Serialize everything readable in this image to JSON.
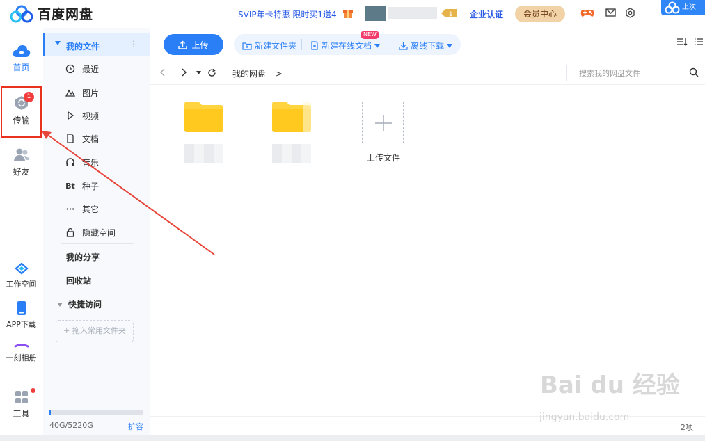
{
  "app": {
    "name": "百度网盘"
  },
  "header": {
    "promo": "SVIP年卡特惠 限时买1送4",
    "svip_badge": "$",
    "enterprise": "企业认证",
    "vip_center": "会员中心",
    "widget_label": "上次"
  },
  "leftnav": {
    "home": "首页",
    "transfer": "传输",
    "transfer_badge": "1",
    "friends": "好友",
    "workspace": "工作空间",
    "app_download": "APP下载",
    "album": "一刻相册",
    "tools": "工具"
  },
  "sidebar": {
    "my_files": "我的文件",
    "more": "⋮",
    "items": [
      {
        "label": "最近",
        "icon": "clock-icon"
      },
      {
        "label": "图片",
        "icon": "image-icon"
      },
      {
        "label": "视频",
        "icon": "play-icon"
      },
      {
        "label": "文档",
        "icon": "document-icon"
      },
      {
        "label": "音乐",
        "icon": "headphones-icon"
      },
      {
        "label": "种子",
        "icon": "bt-icon",
        "glyph": "Bt"
      },
      {
        "label": "其它",
        "icon": "more-dots-icon",
        "glyph": "···"
      },
      {
        "label": "隐藏空间",
        "icon": "lock-icon"
      }
    ],
    "my_share": "我的分享",
    "recycle": "回收站",
    "quick_access": "快捷访问",
    "drop_hint": "+ 拖入常用文件夹",
    "storage_text": "40G/5220G",
    "storage_used_fraction": 0.0077,
    "expand": "扩容"
  },
  "toolbar": {
    "upload": "上传",
    "new_folder": "新建文件夹",
    "new_online_doc": "新建在线文档",
    "new_badge": "NEW",
    "offline_download": "离线下载"
  },
  "pathbar": {
    "breadcrumb": "我的网盘",
    "breadcrumb_sep": ">",
    "search_placeholder": "搜索我的网盘文件"
  },
  "files": {
    "upload_tile_label": "上传文件",
    "item_count": "2项"
  },
  "watermark": {
    "main": "Bai du 经验",
    "sub": "jingyan.baidu.com"
  },
  "colors": {
    "accent": "#2a7ff6",
    "badge_red": "#f23d3d",
    "highlight_red": "#e8321e",
    "folder_yellow": "#ffd43f"
  }
}
